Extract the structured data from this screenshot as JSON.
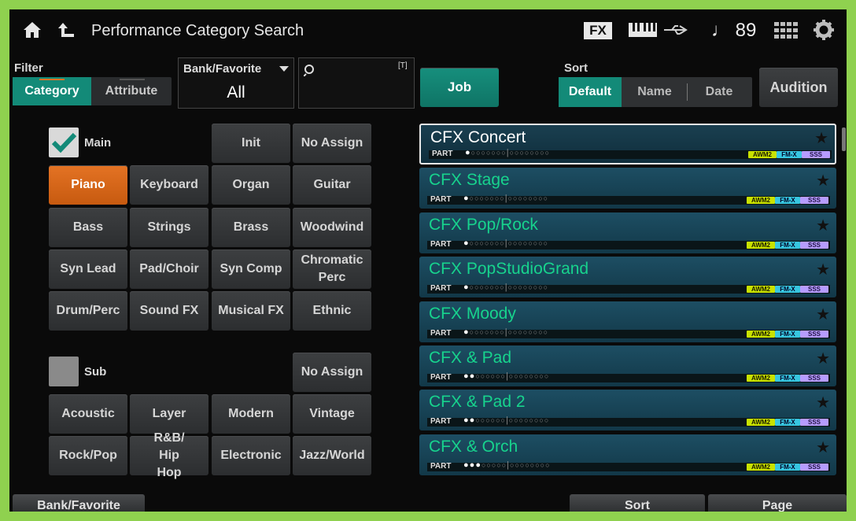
{
  "header": {
    "title": "Performance Category Search",
    "fx_label": "FX",
    "tempo": "♩ 89"
  },
  "filter": {
    "label": "Filter",
    "tabs": [
      "Category",
      "Attribute"
    ],
    "active_tab": "Category"
  },
  "bank": {
    "label": "Bank/Favorite",
    "value": "All"
  },
  "search": {
    "value": "",
    "t_label": "[T]"
  },
  "job_label": "Job",
  "sort": {
    "label": "Sort",
    "options": [
      "Default",
      "Name",
      "Date"
    ],
    "active": "Default"
  },
  "audition_label": "Audition",
  "main": {
    "label": "Main",
    "checked": true,
    "buttons": [
      "Init",
      "No Assign",
      "Piano",
      "Keyboard",
      "Organ",
      "Guitar",
      "Bass",
      "Strings",
      "Brass",
      "Woodwind",
      "Syn Lead",
      "Pad/Choir",
      "Syn Comp",
      "Chromatic Perc",
      "Drum/Perc",
      "Sound FX",
      "Musical FX",
      "Ethnic"
    ],
    "active": "Piano"
  },
  "sub": {
    "label": "Sub",
    "checked": false,
    "buttons": [
      "No Assign",
      "Acoustic",
      "Layer",
      "Modern",
      "Vintage",
      "Rock/Pop",
      "R&B/ Hip Hop",
      "Electronic",
      "Jazz/World"
    ]
  },
  "performances": [
    {
      "name": "CFX Concert",
      "parts": 1,
      "selected": true
    },
    {
      "name": "CFX Stage",
      "parts": 1
    },
    {
      "name": "CFX Pop/Rock",
      "parts": 1
    },
    {
      "name": "CFX PopStudioGrand",
      "parts": 1
    },
    {
      "name": "CFX Moody",
      "parts": 1
    },
    {
      "name": "CFX & Pad",
      "parts": 2
    },
    {
      "name": "CFX & Pad 2",
      "parts": 2
    },
    {
      "name": "CFX & Orch",
      "parts": 3
    }
  ],
  "part_label": "PART",
  "badges": [
    "AWM2",
    "FM-X",
    "SSS"
  ],
  "footer": [
    "Bank/Favorite",
    "Sort",
    "Page"
  ],
  "colors": {
    "accent_orange": "#d8661a",
    "teal": "#138a78",
    "perf_green": "#17d38d",
    "frame_green": "#8fd14f"
  }
}
